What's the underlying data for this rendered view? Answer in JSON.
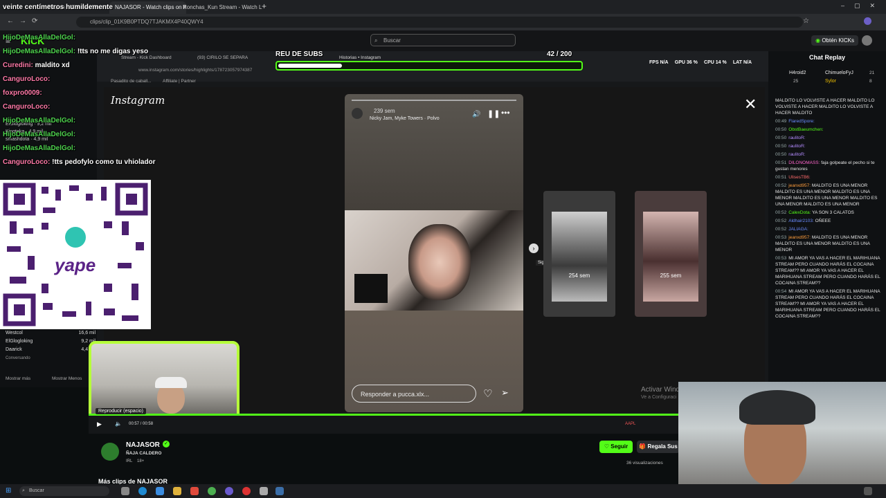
{
  "browser": {
    "tabs": [
      "Stream - Kick Dashboard",
      "NAJASOR - Watch clips on Kick",
      "Ronchas_Kun Stream - Watch L"
    ],
    "url": "clips/clip_01K9B0PTDQ7TJAKMX4P40QWY4"
  },
  "kick": {
    "logo": "KICK",
    "search_placeholder": "Buscar",
    "kicks_button": "Obtén KICKs",
    "chat_title": "Chat Replay"
  },
  "overlay_chat": [
    {
      "user": "veinte",
      "text": "veinte centímetros humildemente"
    },
    {
      "user": "HijoDeMasAllaDelGol:",
      "text": ""
    },
    {
      "user": "HijoDeMasAllaDelGol:",
      "text": ""
    },
    {
      "user": "HijoDeMasAllaDelGol:",
      "text": "!tts no me digas yeso"
    },
    {
      "user": "Curedini:",
      "text": "maldito xd"
    },
    {
      "user": "CanguroLoco:",
      "text": ""
    },
    {
      "user": "foxpro0009:",
      "text": ""
    },
    {
      "user": "CanguroLoco:",
      "text": ""
    },
    {
      "user": "HijoDeMasAllaDelGol:",
      "text": ""
    },
    {
      "user": "HijoDeMasAllaDelGol:",
      "text": ""
    },
    {
      "user": "HijoDeMasAllaDelGol:",
      "text": ""
    },
    {
      "user": "CanguroLoco:",
      "text": "!tts pedofylo como tu vhiolador"
    }
  ],
  "sidebar_bottom": [
    {
      "name": "Westcol",
      "viewers": "16,6 mil"
    },
    {
      "name": "ElGlogloking",
      "viewers": "9,2 mil"
    },
    {
      "name": "Daarick",
      "viewers": "4,4 mil",
      "sub": "Conversando"
    }
  ],
  "sidebar_links": {
    "more": "Mostrar más",
    "less": "Mostrar Menos"
  },
  "sidebar_top": [
    {
      "name": "ElGlogloking",
      "viewers": "9,2 mil"
    },
    {
      "name": "Kingteka",
      "viewers": "4,9 mil"
    },
    {
      "name": "smashdota",
      "viewers": "4,9 mil"
    }
  ],
  "stream": {
    "goal_label": "REU DE SUBS",
    "goal_count": "42 / 200",
    "goal_progress": 0.21,
    "stats": {
      "fps": "FPS N/A",
      "gpu": "GPU 36 %",
      "cpu": "CPU 14 %",
      "lat": "LAT N/A"
    },
    "inner_tabs": [
      "Stream - Kick Dashboard",
      "(93) CIRILO SE SEPARA",
      "Historias • Instagram"
    ],
    "inner_url": "www.instagram.com/stories/highlights/178723057974387",
    "inner_bookmarks": [
      "Pasadito de caball...",
      "Affiliate | Partner"
    ]
  },
  "instagram": {
    "logo": "Instagram",
    "story_time": "239 sem",
    "story_music": "Nicky Jam, Myke Towers · Polvo",
    "reply_placeholder": "Responder a pucca.xlx...",
    "next_label": "Siguiente",
    "previews": [
      {
        "time": "254 sem"
      },
      {
        "time": "255 sem"
      }
    ],
    "watermark": "Activar Wind",
    "watermark_sub": "Ve a Configuraci"
  },
  "player": {
    "tooltip": "Reproducir (espacio)",
    "time": "00:57 / 00:58",
    "right_label": "AAPL"
  },
  "channel": {
    "name": "NAJASOR",
    "category": "ÑAJA CALDERO",
    "tags": [
      "IRL",
      "18+"
    ],
    "follow": "Seguir",
    "gift": "Regala Sus",
    "views": "36 visualizaciones",
    "more_clips": "Más clips de NAJASOR"
  },
  "chat_header_users": [
    {
      "name": "H4roid2",
      "score": "25"
    },
    {
      "name": "ChimueloFyJ",
      "score": "21"
    },
    {
      "name": "Sylor",
      "score": "8"
    }
  ],
  "chat_replay": [
    {
      "time": "",
      "user": "",
      "text": "MALDITO LO VOLVISTE A HACER MALDITO LO VOLVISTE A HACER MALDITO LO VOLVISTE A HACER MALDITO"
    },
    {
      "time": "00:49",
      "user": "FlaredSpore:",
      "text": ""
    },
    {
      "time": "00:50",
      "user": "ObstBaeumchen:",
      "text": ""
    },
    {
      "time": "00:50",
      "user": "raulitoR:",
      "text": ""
    },
    {
      "time": "00:50",
      "user": "raulitoR:",
      "text": ""
    },
    {
      "time": "00:50",
      "user": "raulitoR:",
      "text": ""
    },
    {
      "time": "00:51",
      "user": "DILONOMASS:",
      "text": "faja golpeate el pecho si te gustan menores"
    },
    {
      "time": "00:51",
      "user": "UlisesTB6:",
      "text": ""
    },
    {
      "time": "00:52",
      "user": "jeanxd957:",
      "text": "MALDITO ES UNA MENOR MALDITO ES UNA MENOR MALDITO ES UNA MENOR MALDITO ES UNA MENOR MALDITO ES UNA MENOR MALDITO ES UNA MENOR"
    },
    {
      "time": "00:52",
      "user": "CalexDota:",
      "text": "YA SON 3 CALATOS"
    },
    {
      "time": "00:52",
      "user": "Aldhair2103:",
      "text": "OÑEEE"
    },
    {
      "time": "00:52",
      "user": "JALIAGA:",
      "text": ""
    },
    {
      "time": "00:53",
      "user": "jeanxd957:",
      "text": "MALDITO ES UNA MENOR MALDITO ES UNA MENOR MALDITO ES UNA MENOR"
    },
    {
      "time": "00:53",
      "user": "",
      "text": "MI AMOR YA VAS A HACER EL MARIHUANA STREAM PERO CUANDO HARÁS EL COCAINA STREAM?? MI AMOR YA VAS A HACER EL MARIHUANA STREAM PERO CUANDO HARÁS EL COCAINA STREAM??"
    },
    {
      "time": "00:54",
      "user": "",
      "text": "MI AMOR YA VAS A HACER EL MARIHUANA STREAM PERO CUANDO HARÁS EL COCAINA STREAM?? MI AMOR YA VAS A HACER EL MARIHUANA STREAM PERO CUANDO HARÁS EL COCAINA STREAM??"
    }
  ],
  "taskbar": {
    "search": "Buscar"
  },
  "colors": {
    "kick_green": "#53fc18",
    "bg": "#0b0e0f",
    "webcam_border": "#b6ff3a"
  },
  "icons": [
    "search-icon",
    "close-icon",
    "heart-icon",
    "send-icon",
    "mute-icon",
    "pause-icon",
    "more-icon",
    "chevron-right-icon",
    "verified-icon",
    "windows-icon"
  ]
}
